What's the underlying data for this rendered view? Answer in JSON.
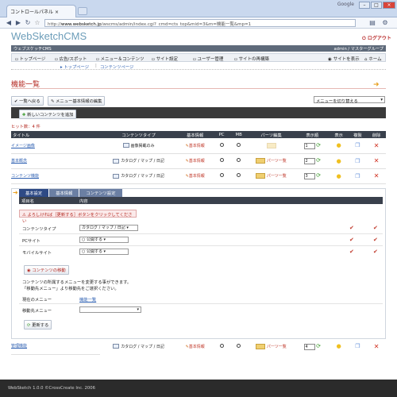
{
  "browser": {
    "tab_title": "コントロールパネル",
    "google_label": "Google",
    "url_prefix": "http://",
    "url_host": "www.websketch.jp",
    "url_path": "/wscms/admin/index.cgi?_cmd=cts_top&mid=3&m=機能一覧&mp=1"
  },
  "app": {
    "logo": "WebSketchCMS",
    "logout": "ログアウト",
    "site_name": "ウェブスケッチCMS",
    "user_info": "admin / マスターグループ"
  },
  "menu": {
    "items": [
      "トップページ",
      "広告/スポット",
      "メニュー＆コンテンツ",
      "サイト設定",
      "ユーザー管理",
      "サイトの再構築"
    ],
    "view_site": "サイトを表示",
    "home": "ホーム"
  },
  "subnav": {
    "items": [
      "トップページ",
      "コンテンツページ"
    ]
  },
  "page": {
    "title": "機能一覧",
    "back_button": "一覧へ戻る",
    "edit_menu_button": "メニュー基本情報の編集",
    "filter_select": "メニューを切り替える",
    "add_button": "新しいコンテンツを追加",
    "hit_count": "ヒット数：4 件"
  },
  "table": {
    "headers": [
      "タイトル",
      "コンテンツタイプ",
      "基本情報",
      "PC",
      "MB",
      "パーツ編集",
      "表示順",
      "表示",
      "複製",
      "削除"
    ],
    "rows": [
      {
        "title": "イメージ画像",
        "type": "画像掲載のみ",
        "info": "基本情報",
        "parts": "",
        "order": "1"
      },
      {
        "title": "基本概念",
        "type": "カタログ / マップ / 日記",
        "info": "基本情報",
        "parts": "パーツ一覧",
        "order": "2"
      },
      {
        "title": "コンテンツ機能",
        "type": "カタログ / マップ / 日記",
        "info": "基本情報",
        "parts": "パーツ一覧",
        "order": "3"
      },
      {
        "title": "管理機能",
        "type": "カタログ / マップ / 日記",
        "info": "基本情報",
        "parts": "パーツ一覧",
        "order": "4"
      }
    ]
  },
  "edit": {
    "tabs": [
      "基本設定",
      "基本情報",
      "コンテンツ設定"
    ],
    "col_item": "項目名",
    "col_content": "内容",
    "notice": "よろしければ［更新する］ボタンをクリックしてください",
    "fields": [
      {
        "label": "コンテンツタイプ",
        "value": "カタログ / マップ / 日記"
      },
      {
        "label": "PCサイト",
        "value": "○ 公開する"
      },
      {
        "label": "モバイルサイト",
        "value": "○ 公開する"
      }
    ],
    "move_button": "コンテンツの移動",
    "move_desc1": "コンテンツの所属するメニューを変更する事ができます。",
    "move_desc2": "「移動先メニュー」より移動先をご選択ください。",
    "current_menu_label": "現在のメニュー",
    "current_menu_value": "機能一覧",
    "dest_menu_label": "移動先メニュー",
    "dest_menu_value": "",
    "update_button": "更新する"
  },
  "footer": {
    "text": "WebSketch 1.0.0  ©CrossCreate Inc. 2006"
  }
}
